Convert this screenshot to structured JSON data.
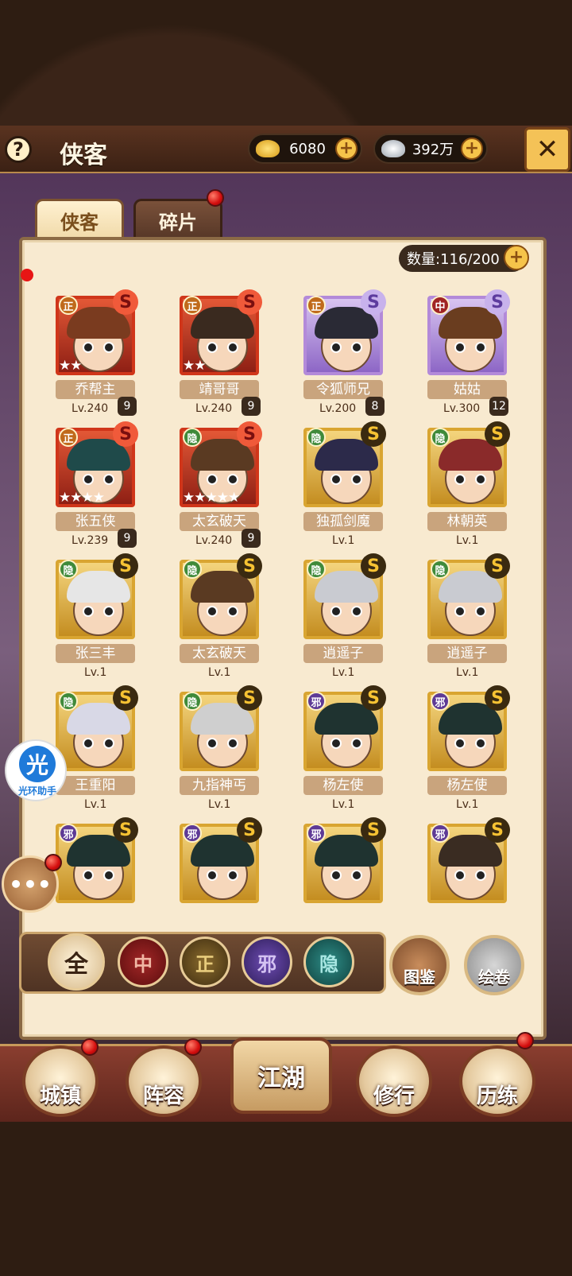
{
  "header": {
    "help_icon": "?",
    "title": "侠客",
    "gold": "6080",
    "silver": "392万",
    "close_icon": "crossed-swords-icon"
  },
  "tabs": [
    {
      "label": "侠客"
    },
    {
      "label": "碎片"
    }
  ],
  "count": {
    "label": "数量:116/200"
  },
  "heroes": [
    {
      "name": "乔帮主",
      "rank": "正",
      "grade": "S",
      "level": "Lv.240",
      "badge": "9",
      "stars": "★★",
      "frame": "red"
    },
    {
      "name": "靖哥哥",
      "rank": "正",
      "grade": "S",
      "level": "Lv.240",
      "badge": "9",
      "stars": "★★",
      "frame": "red"
    },
    {
      "name": "令狐师兄",
      "rank": "正",
      "grade": "S",
      "level": "Lv.200",
      "badge": "8",
      "stars": "",
      "frame": "purple"
    },
    {
      "name": "姑姑",
      "rank": "中",
      "grade": "S",
      "level": "Lv.300",
      "badge": "12",
      "stars": "",
      "frame": "purple"
    },
    {
      "name": "张五侠",
      "rank": "正",
      "grade": "S",
      "level": "Lv.239",
      "badge": "9",
      "stars": "★★★★",
      "frame": "red"
    },
    {
      "name": "太玄破天",
      "rank": "隐",
      "grade": "S",
      "level": "Lv.240",
      "badge": "9",
      "stars": "★★★★★",
      "frame": "red"
    },
    {
      "name": "独孤剑魔",
      "rank": "隐",
      "grade": "S",
      "level": "Lv.1",
      "badge": "",
      "stars": "",
      "frame": "gold"
    },
    {
      "name": "林朝英",
      "rank": "隐",
      "grade": "S",
      "level": "Lv.1",
      "badge": "",
      "stars": "",
      "frame": "gold"
    },
    {
      "name": "张三丰",
      "rank": "隐",
      "grade": "S",
      "level": "Lv.1",
      "badge": "",
      "stars": "",
      "frame": "gold"
    },
    {
      "name": "太玄破天",
      "rank": "隐",
      "grade": "S",
      "level": "Lv.1",
      "badge": "",
      "stars": "",
      "frame": "gold"
    },
    {
      "name": "逍遥子",
      "rank": "隐",
      "grade": "S",
      "level": "Lv.1",
      "badge": "",
      "stars": "",
      "frame": "gold"
    },
    {
      "name": "逍遥子",
      "rank": "隐",
      "grade": "S",
      "level": "Lv.1",
      "badge": "",
      "stars": "",
      "frame": "gold"
    },
    {
      "name": "王重阳",
      "rank": "隐",
      "grade": "S",
      "level": "Lv.1",
      "badge": "",
      "stars": "",
      "frame": "gold"
    },
    {
      "name": "九指神丐",
      "rank": "隐",
      "grade": "S",
      "level": "Lv.1",
      "badge": "",
      "stars": "",
      "frame": "gold"
    },
    {
      "name": "杨左使",
      "rank": "邪",
      "grade": "S",
      "level": "Lv.1",
      "badge": "",
      "stars": "",
      "frame": "gold"
    },
    {
      "name": "杨左使",
      "rank": "邪",
      "grade": "S",
      "level": "Lv.1",
      "badge": "",
      "stars": "",
      "frame": "gold"
    },
    {
      "name": "",
      "rank": "邪",
      "grade": "S",
      "level": "",
      "badge": "",
      "stars": "",
      "frame": "gold"
    },
    {
      "name": "",
      "rank": "邪",
      "grade": "S",
      "level": "",
      "badge": "",
      "stars": "",
      "frame": "gold"
    },
    {
      "name": "",
      "rank": "邪",
      "grade": "S",
      "level": "",
      "badge": "",
      "stars": "",
      "frame": "gold"
    },
    {
      "name": "",
      "rank": "邪",
      "grade": "S",
      "level": "",
      "badge": "",
      "stars": "",
      "frame": "gold"
    }
  ],
  "filters": [
    {
      "label": "全"
    },
    {
      "label": "中"
    },
    {
      "label": "正"
    },
    {
      "label": "邪"
    },
    {
      "label": "隐"
    }
  ],
  "side_buttons": {
    "tujian": "图鉴",
    "huijuan": "绘卷"
  },
  "floating": {
    "guang": "光",
    "guang_text": "光环助手",
    "chat_icon": "chat-bubble-icon"
  },
  "nav": [
    {
      "label": "城镇"
    },
    {
      "label": "阵容"
    },
    {
      "label": "江湖"
    },
    {
      "label": "修行"
    },
    {
      "label": "历练"
    }
  ]
}
